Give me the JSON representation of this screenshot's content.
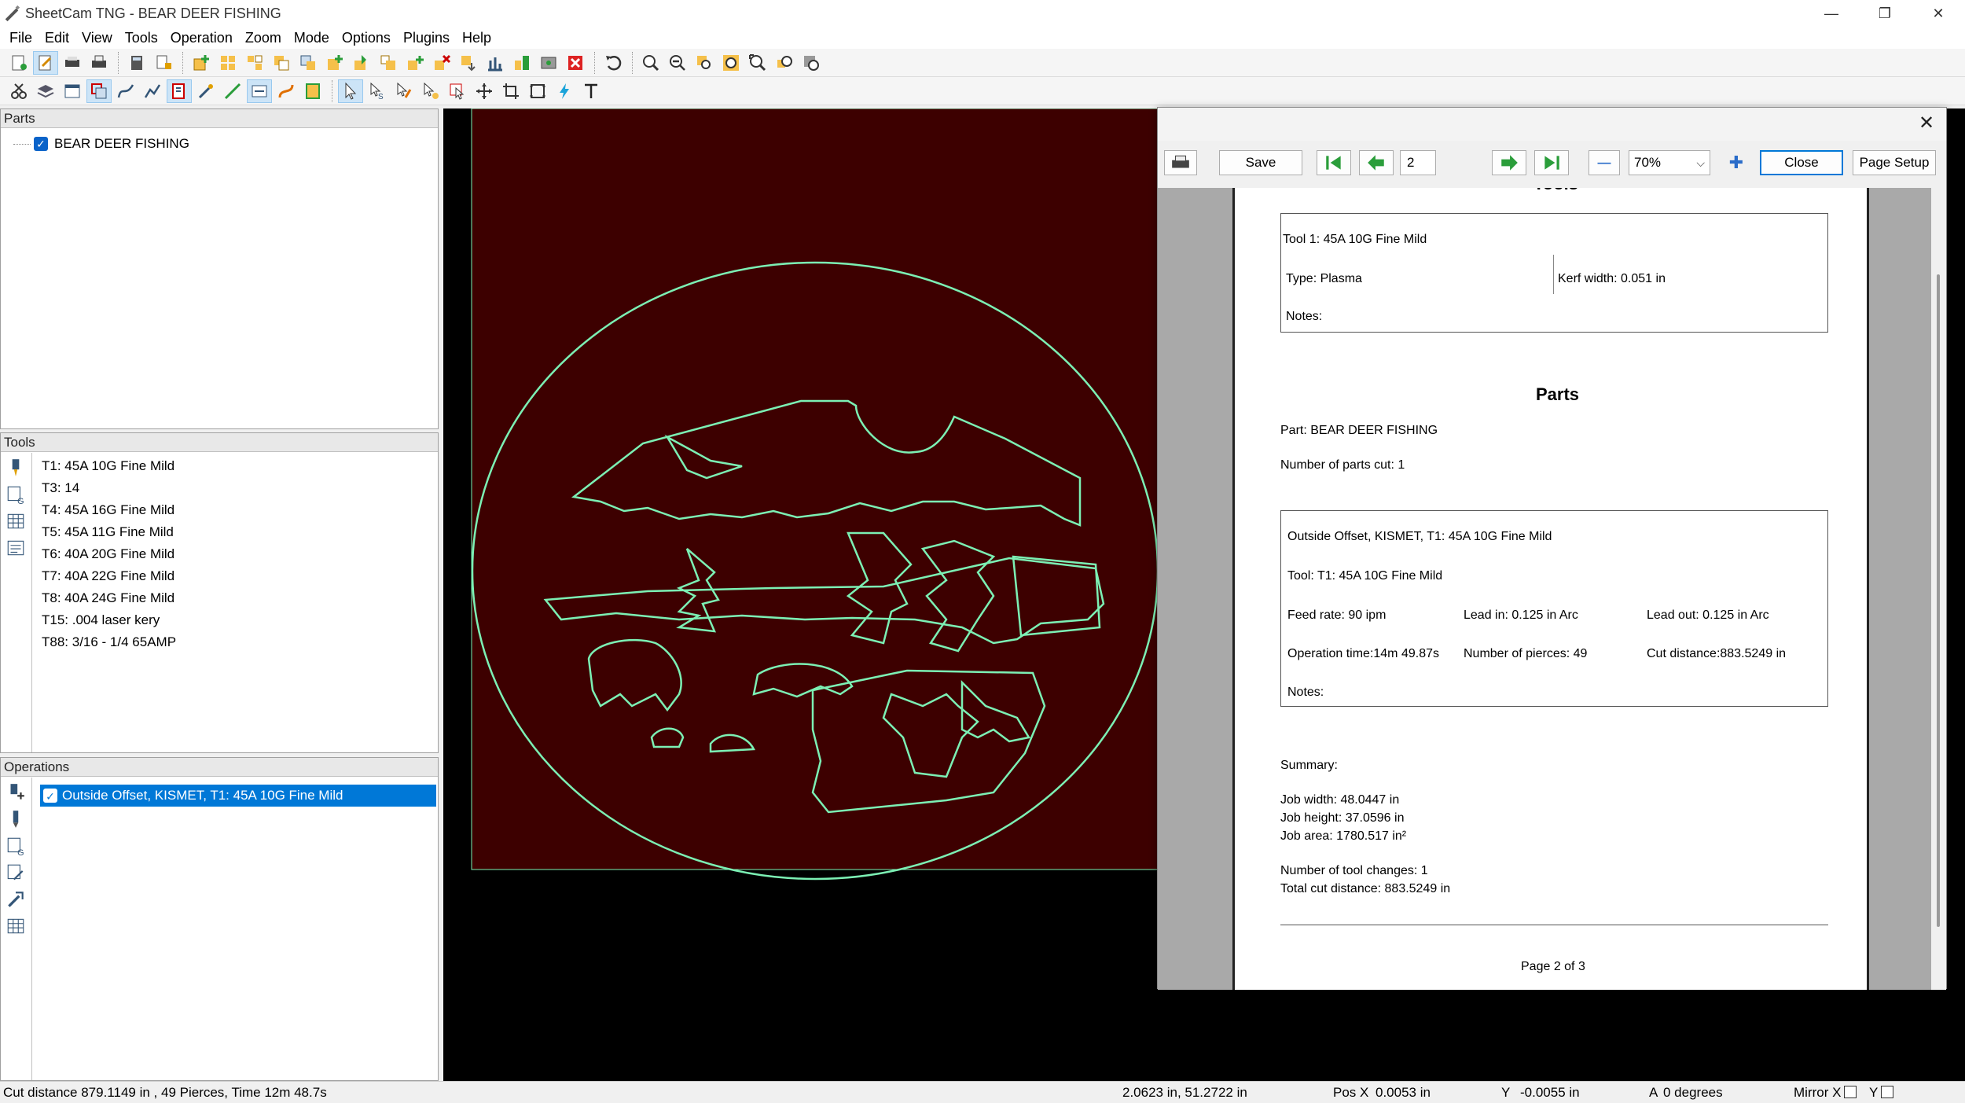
{
  "window": {
    "title": "SheetCam TNG - BEAR DEER FISHING",
    "minimize": "—",
    "maximize": "❐",
    "close": "✕"
  },
  "menu": [
    "File",
    "Edit",
    "View",
    "Tools",
    "Operation",
    "Zoom",
    "Mode",
    "Options",
    "Plugins",
    "Help"
  ],
  "parts": {
    "header": "Parts",
    "items": [
      {
        "label": "BEAR DEER FISHING",
        "checked": true
      }
    ]
  },
  "tools": {
    "header": "Tools",
    "items": [
      "T1: 45A 10G Fine Mild",
      "T3: 14",
      "T4: 45A 16G Fine Mild",
      "T5: 45A 11G Fine Mild",
      "T6: 40A 20G Fine Mild",
      "T7: 40A 22G Fine Mild",
      "T8: 40A 24G Fine Mild",
      "T15: .004 laser kery",
      "T88: 3/16 - 1/4 65AMP"
    ]
  },
  "operations": {
    "header": "Operations",
    "items": [
      {
        "label": "Outside Offset, KISMET, T1: 45A 10G Fine Mild",
        "checked": true,
        "selected": true
      }
    ]
  },
  "preview": {
    "close": "✕",
    "save": "Save",
    "page_input": "2",
    "zoom": "70%",
    "close_button": "Close",
    "page_setup": "Page Setup",
    "zoom_arrow": "⌵",
    "minus": "—",
    "plus": "✚"
  },
  "report": {
    "cut_heading": "Tools",
    "tool_box": {
      "title": "Tool 1: 45A 10G Fine Mild",
      "type": "Type: Plasma",
      "kerf": "Kerf width: 0.051 in",
      "notes": "Notes:"
    },
    "parts_heading": "Parts",
    "part_name": "Part: BEAR DEER FISHING",
    "parts_cut": "Number of parts cut: 1",
    "op_box": {
      "title": "Outside Offset, KISMET, T1: 45A 10G Fine Mild",
      "tool": "Tool: T1: 45A 10G Fine Mild",
      "feed": "Feed rate: 90 ipm",
      "lead_in": "Lead in: 0.125 in Arc",
      "lead_out": "Lead out: 0.125 in Arc",
      "op_time": "Operation time:14m 49.87s",
      "pierces": "Number of pierces: 49",
      "cut_distance": "Cut distance:883.5249 in",
      "notes": "Notes:"
    },
    "summary_heading": "Summary:",
    "job_width": "Job width: 48.0447 in",
    "job_height": "Job height: 37.0596 in",
    "job_area": "Job area: 1780.517 in²",
    "tool_changes": "Number of tool changes: 1",
    "total_cut": "Total cut distance: 883.5249 in",
    "page_footer": "Page 2 of 3"
  },
  "status": {
    "summary": "Cut distance 879.1149 in , 49 Pierces, Time 12m 48.7s",
    "cursor": "2.0623 in, 51.2722 in",
    "pos_x_label": "Pos X",
    "pos_x": "0.0053 in",
    "y_label": "Y",
    "y_val": "-0.0055 in",
    "a_label": "A",
    "a_val": "0 degrees",
    "mirror_x": "Mirror X",
    "mirror_y": "Y"
  },
  "colors": {
    "canvas_sheet": "#3d0000",
    "path": "#7cf0b4",
    "selection": "#0078d7"
  }
}
